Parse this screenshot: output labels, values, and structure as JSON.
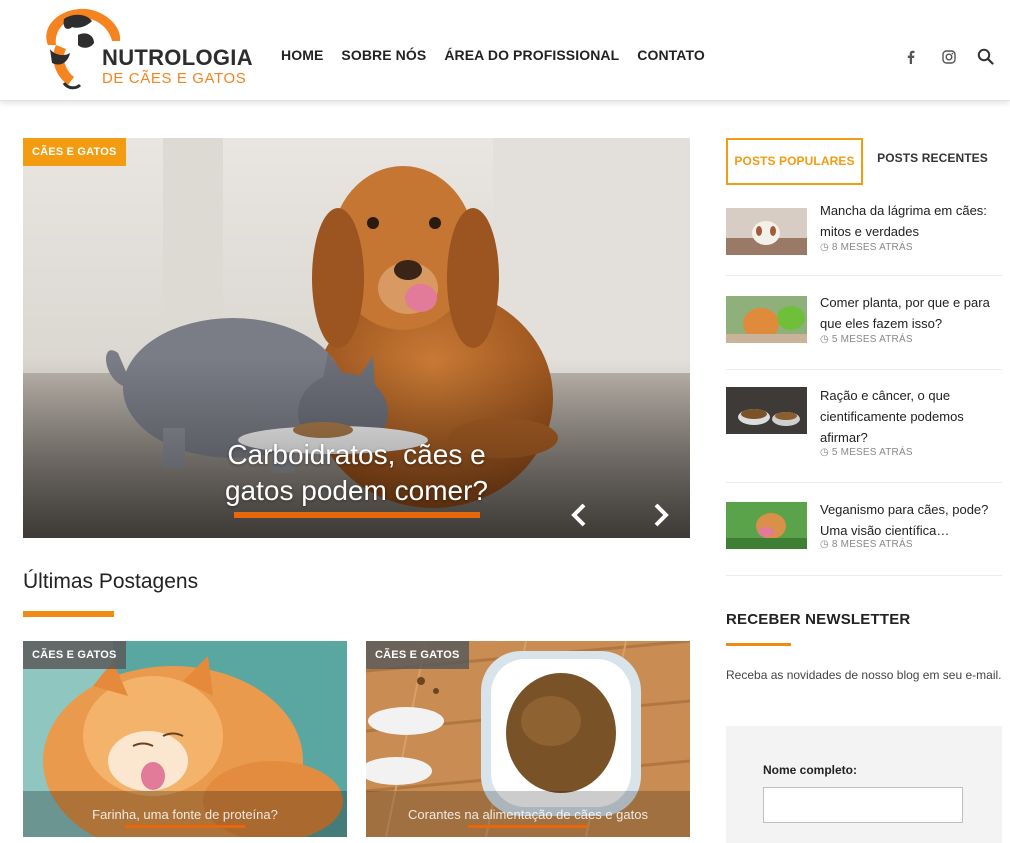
{
  "header": {
    "logo_title": "NUTROLOGIA",
    "logo_subtitle": "DE CÃES E GATOS",
    "nav": [
      "HOME",
      "SOBRE NÓS",
      "ÁREA DO PROFISSIONAL",
      "CONTATO"
    ],
    "icons": [
      "facebook-icon",
      "instagram-icon",
      "search-icon"
    ]
  },
  "colors": {
    "accent": "#f39c12",
    "accent_dark": "#e8660c",
    "badge_gray": "#5a5a5a"
  },
  "slider": {
    "category": "CÃES E GATOS",
    "title_line1": "Carboidratos, cães e",
    "title_line2": "gatos podem comer?",
    "prev_icon": "chevron-left-icon",
    "next_icon": "chevron-right-icon"
  },
  "latest": {
    "heading": "Últimas Postagens",
    "posts": [
      {
        "category": "CÃES E GATOS",
        "title": "Farinha, uma fonte de proteína?"
      },
      {
        "category": "CÃES E GATOS",
        "title": "Corantes na alimentação de cães e gatos"
      }
    ]
  },
  "sidebar": {
    "tabs": [
      "POSTS POPULARES",
      "POSTS RECENTES"
    ],
    "popular": [
      {
        "title": "Mancha da lágrima em cães: mitos e verdades",
        "date": "8 MESES ATRÁS"
      },
      {
        "title": "Comer planta, por que e para que eles fazem isso?",
        "date": "5 MESES ATRÁS"
      },
      {
        "title": "Ração e câncer, o que cientificamente podemos afirmar?",
        "date": "5 MESES ATRÁS"
      },
      {
        "title": "Veganismo para cães, pode? Uma visão científica…",
        "date": "8 MESES ATRÁS"
      }
    ],
    "newsletter": {
      "title": "RECEBER NEWSLETTER",
      "text": "Receba as novidades de nosso blog em seu e-mail.",
      "name_label": "Nome completo:",
      "name_value": ""
    }
  }
}
